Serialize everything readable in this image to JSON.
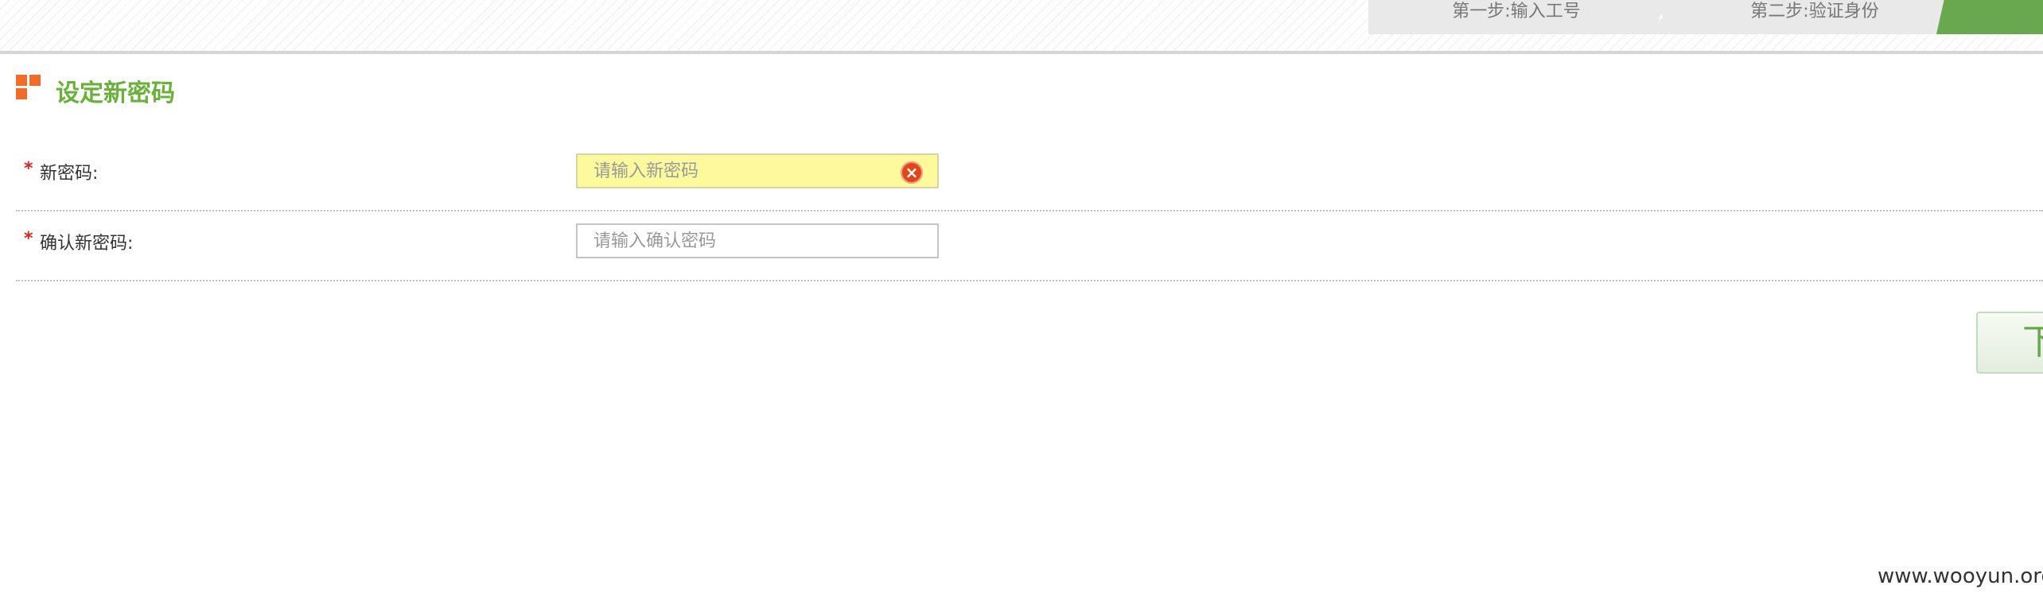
{
  "steps": [
    {
      "label": "第一步:输入工号"
    },
    {
      "label": "第二步:验证身份"
    },
    {
      "label": ""
    }
  ],
  "section": {
    "title": "设定新密码"
  },
  "form": {
    "required_mark": "*",
    "new_password": {
      "label": "新密码:",
      "placeholder": "请输入新密码",
      "state": "error"
    },
    "confirm_password": {
      "label": "确认新密码:",
      "placeholder": "请输入确认密码"
    }
  },
  "next_button": {
    "label": "下"
  },
  "watermark": "www.wooyun.org",
  "colors": {
    "accent": "#6ab13c",
    "icon_orange": "#f26b28",
    "error_bg": "#fdfa9d",
    "required": "#e02020"
  },
  "icons": {
    "error_icon": "x-circle",
    "section_icon": "grid-squares"
  }
}
